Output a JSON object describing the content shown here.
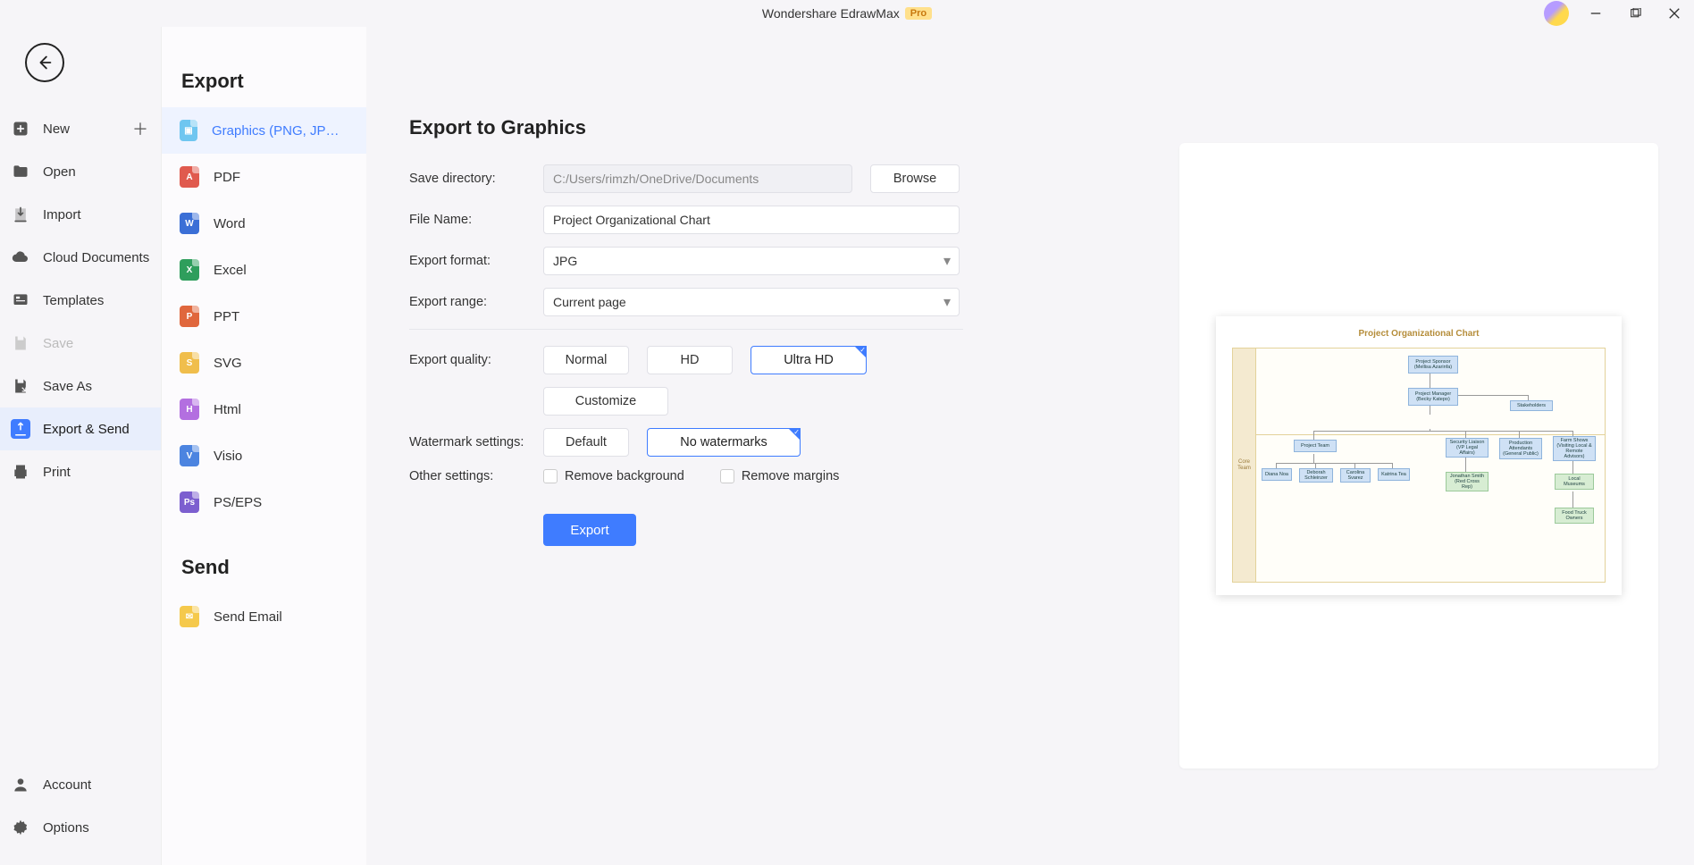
{
  "app": {
    "title": "Wondershare EdrawMax",
    "badge": "Pro"
  },
  "primary": {
    "new": "New",
    "open": "Open",
    "import": "Import",
    "cloud": "Cloud Documents",
    "templates": "Templates",
    "save": "Save",
    "saveas": "Save As",
    "exportsend": "Export & Send",
    "print": "Print",
    "account": "Account",
    "options": "Options"
  },
  "secondary": {
    "heading_export": "Export",
    "heading_send": "Send",
    "items": {
      "graphics": "Graphics (PNG, JPG et...",
      "pdf": "PDF",
      "word": "Word",
      "excel": "Excel",
      "ppt": "PPT",
      "svg": "SVG",
      "html": "Html",
      "visio": "Visio",
      "pseps": "PS/EPS",
      "sendemail": "Send Email"
    }
  },
  "main": {
    "heading": "Export to Graphics",
    "labels": {
      "savedir": "Save directory:",
      "filename": "File Name:",
      "format": "Export format:",
      "range": "Export range:",
      "quality": "Export quality:",
      "watermark": "Watermark settings:",
      "other": "Other settings:"
    },
    "savedir": "C:/Users/rimzh/OneDrive/Documents",
    "browse": "Browse",
    "filename": "Project Organizational Chart",
    "format": "JPG",
    "range": "Current page",
    "quality": {
      "normal": "Normal",
      "hd": "HD",
      "ultra": "Ultra HD",
      "custom": "Customize"
    },
    "watermark": {
      "default": "Default",
      "none": "No watermarks"
    },
    "other": {
      "removebg": "Remove background",
      "removemargins": "Remove margins"
    },
    "export": "Export"
  },
  "preview": {
    "title": "Project Organizational Chart",
    "side": "Core Team",
    "nodes": {
      "sponsor": "Project Sponsor (Mellisa Azarinfa)",
      "pm": "Project Manager (Becky Katepo)",
      "stake": "Stakeholders",
      "team": "Project Team",
      "liaison": "Security Liaison (VP Legal Affairs)",
      "prod": "Production Attendants (General Public)",
      "tours": "Farm Shows (Visiting Local & Remote Advisors)",
      "diana": "Diana Noa",
      "deborah": "Deborah Schleinzer",
      "carolina": "Carolina Svarez",
      "katrina": "Katrina Tea",
      "jon": "Jonathan Smith (Red Cross Rep)",
      "local": "Local Museums",
      "food": "Food Truck Owners"
    }
  }
}
